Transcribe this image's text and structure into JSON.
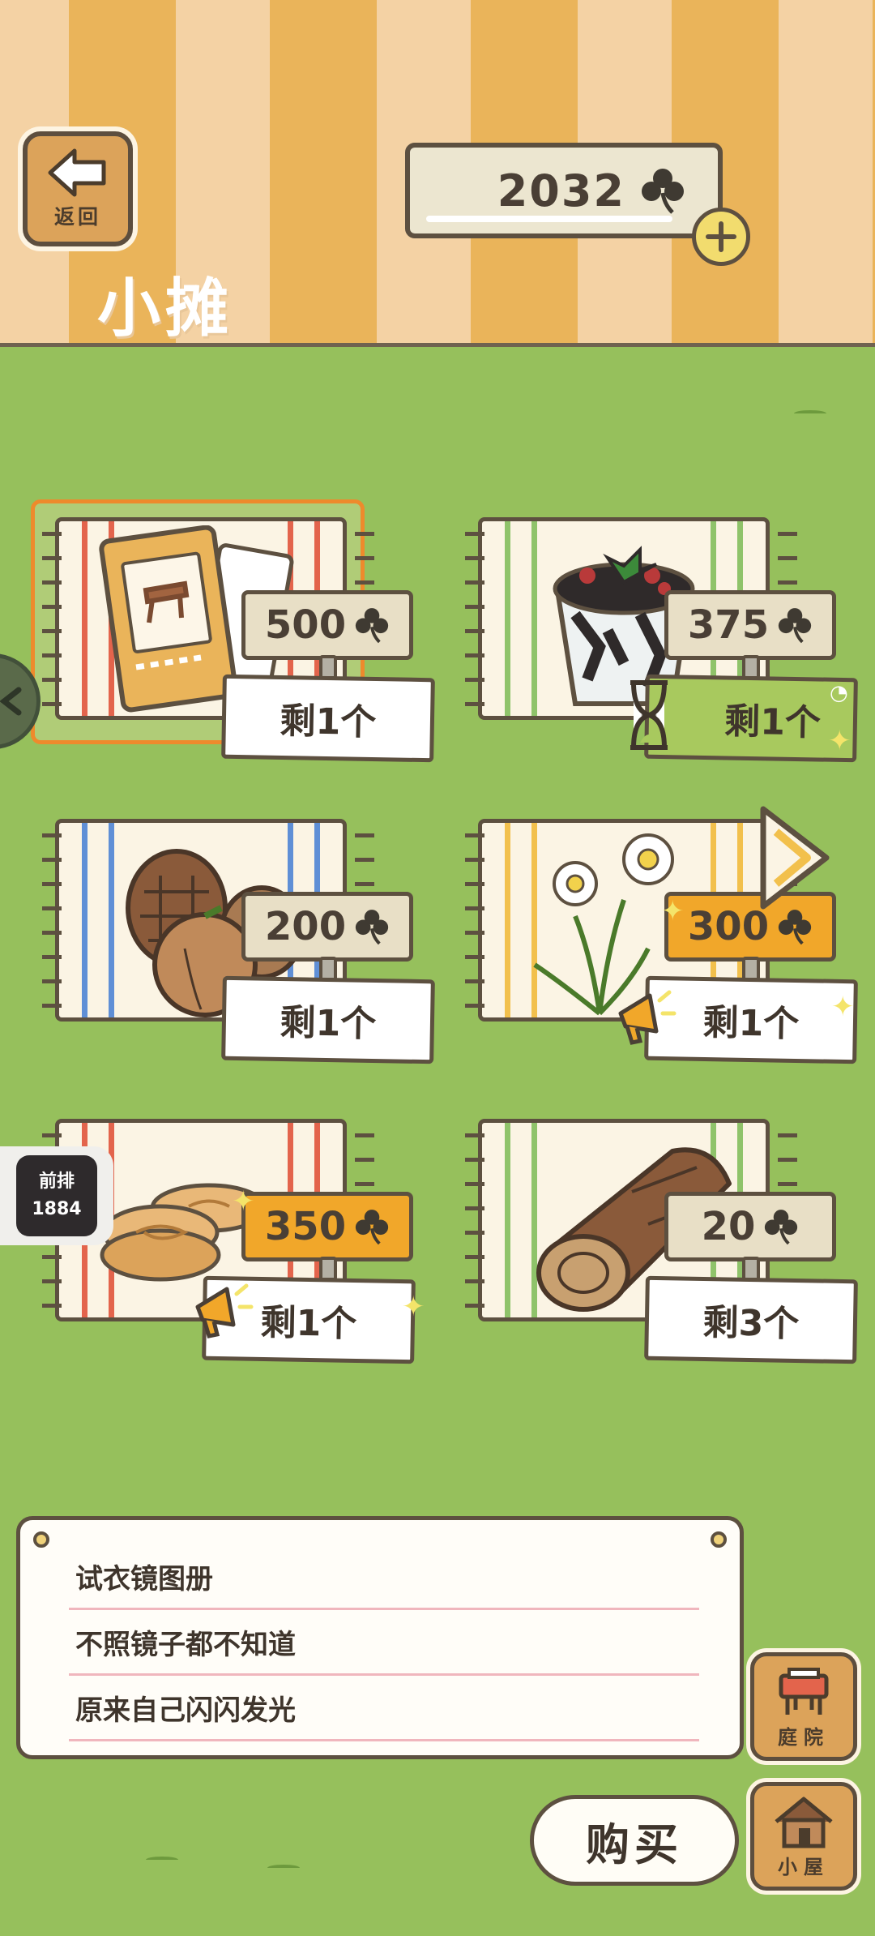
{
  "header": {
    "back_label": "返回",
    "title": "小摊",
    "currency_amount": "2032",
    "currency_icon": "clover-icon"
  },
  "items": [
    {
      "name": "试衣镜图册",
      "price": "500",
      "stock": "剩1个",
      "selected": true,
      "art": "mirror-catalog"
    },
    {
      "name": "jelly-dessert",
      "price": "375",
      "stock": "剩1个",
      "badge": "hourglass-icon",
      "art": "grass-jelly"
    },
    {
      "name": "pinecone-and-nut",
      "price": "200",
      "stock": "剩1个",
      "art": "pinecone"
    },
    {
      "name": "daffodils",
      "price": "300",
      "stock": "剩1个",
      "badge": "megaphone-icon",
      "hot": true,
      "art": "flowers"
    },
    {
      "name": "pancakes",
      "price": "350",
      "stock": "剩1个",
      "badge": "megaphone-icon",
      "hot": true,
      "art": "pancakes"
    },
    {
      "name": "log",
      "price": "20",
      "stock": "剩3个",
      "art": "log"
    }
  ],
  "side": {
    "front_row_label": "前排",
    "front_row_number": "1884"
  },
  "description": {
    "title": "试衣镜图册",
    "line1": "不照镜子都不知道",
    "line2": "原来自己闪闪发光"
  },
  "actions": {
    "buy_label": "购买",
    "yard_label": "庭院",
    "house_label": "小屋"
  },
  "colors": {
    "grass": "#96c05c",
    "header_stripe_light": "#f4d2a4",
    "header_stripe_dark": "#eab45a",
    "selected_outline": "#ee8a2c",
    "hot_price": "#f1a72a"
  }
}
